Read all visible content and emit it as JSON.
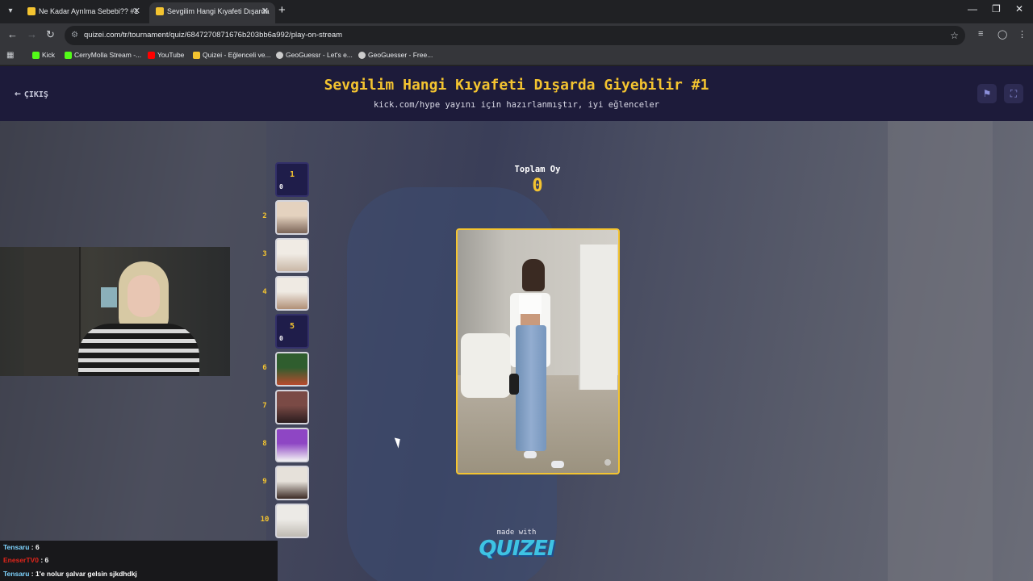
{
  "browser": {
    "tabs": [
      {
        "title": "Ne Kadar Ayrılma Sebebi?? #1",
        "favicon_color": "#f4c430"
      },
      {
        "title": "Sevgilim Hangi Kıyafeti Dışarda",
        "favicon_color": "#f4c430"
      }
    ],
    "new_tab_label": "+",
    "address": "quizei.com/tr/tournament/quiz/6847270871676b203bb6a992/play-on-stream",
    "bookmarks": [
      {
        "label": "Kick",
        "color": "#53fc18"
      },
      {
        "label": "CerryMolla Stream -...",
        "color": "#53fc18"
      },
      {
        "label": "YouTube",
        "color": "#ff0000"
      },
      {
        "label": "Quizei - Eğlenceli ve...",
        "color": "#f4c430"
      },
      {
        "label": "GeoGuessr - Let's e...",
        "color": "#cccccc"
      },
      {
        "label": "GeoGuesser - Free...",
        "color": "#cccccc"
      }
    ]
  },
  "header": {
    "exit_label": "ÇIKIŞ",
    "title": "Sevgilim Hangi Kıyafeti Dışarda Giyebilir #1",
    "subtitle": "kick.com/hype yayını için hazırlanmıştır, iyi eğlenceler"
  },
  "bracket": {
    "slots": [
      {
        "number": "1",
        "type": "empty",
        "votes": "0"
      },
      {
        "number": "2",
        "type": "image",
        "colors": [
          "#e4d2bf",
          "#7c6558"
        ]
      },
      {
        "number": "3",
        "type": "image",
        "colors": [
          "#f0ebe4",
          "#c9b7a6"
        ]
      },
      {
        "number": "4",
        "type": "image",
        "colors": [
          "#efeae3",
          "#b19077"
        ]
      },
      {
        "number": "5",
        "type": "empty",
        "votes": "0"
      },
      {
        "number": "6",
        "type": "image",
        "colors": [
          "#2f5d2e",
          "#b84b2e"
        ]
      },
      {
        "number": "7",
        "type": "image",
        "colors": [
          "#7a4a45",
          "#2a1c1e"
        ]
      },
      {
        "number": "8",
        "type": "image",
        "colors": [
          "#8e46c4",
          "#f2f0f4"
        ]
      },
      {
        "number": "9",
        "type": "image",
        "colors": [
          "#e6e1da",
          "#3b2a24"
        ]
      },
      {
        "number": "10",
        "type": "image",
        "colors": [
          "#eceae6",
          "#bfbab2"
        ]
      }
    ]
  },
  "votes": {
    "label": "Toplam Oy",
    "value": "0"
  },
  "footer": {
    "made_with": "made with",
    "brand": "QUIZEI"
  },
  "chat": [
    {
      "user": "Tensaru",
      "message": " : 6",
      "color": "#7fd4ff"
    },
    {
      "user": "EneserTV0",
      "message": " : 6",
      "color": "#e1251b"
    },
    {
      "user": "Tensaru",
      "message": " : 1'e nolur şalvar gelsin sjkdhdkj",
      "color": "#7fd4ff"
    }
  ]
}
